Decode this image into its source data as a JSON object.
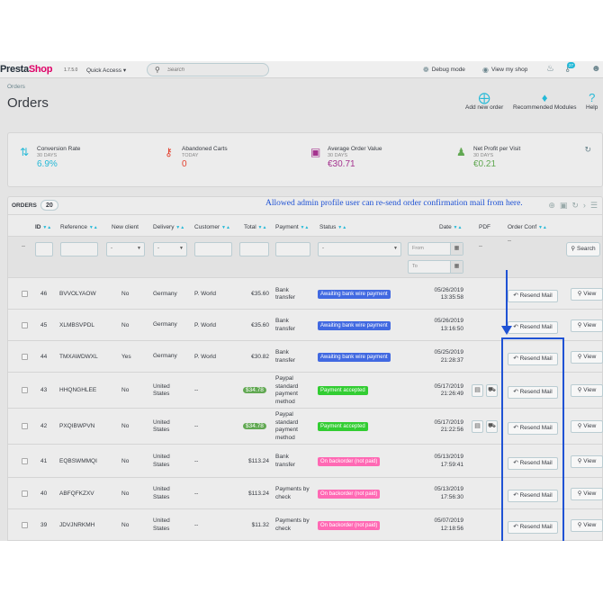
{
  "topbar": {
    "logo_a": "Presta",
    "logo_b": "Shop",
    "version": "1.7.5.0",
    "quick_access": "Quick Access ▾",
    "search_placeholder": "Search",
    "debug_mode": "Debug mode",
    "view_shop": "View my shop",
    "cart_badge": "27"
  },
  "header": {
    "breadcrumb": "Orders",
    "title": "Orders",
    "add_new_order": "Add new order",
    "recommended_modules": "Recommended Modules",
    "help": "Help"
  },
  "kpis": [
    {
      "title": "Conversion Rate",
      "period": "30 DAYS",
      "value": "6.9%",
      "color": "#25b9d7"
    },
    {
      "title": "Abandoned Carts",
      "period": "TODAY",
      "value": "0",
      "color": "#e3412f"
    },
    {
      "title": "Average Order Value",
      "period": "30 DAYS",
      "value": "€30.71",
      "color": "#a5348f"
    },
    {
      "title": "Net Profit per Visit",
      "period": "30 DAYS",
      "value": "€0.21",
      "color": "#61a852"
    }
  ],
  "orders_panel": {
    "title": "ORDERS",
    "count": "20",
    "annotation": "Allowed admin profile user can re-send order confirmation mail from here."
  },
  "columns": {
    "id": "ID",
    "reference": "Reference",
    "new_client": "New client",
    "delivery": "Delivery",
    "customer": "Customer",
    "total": "Total",
    "payment": "Payment",
    "status": "Status",
    "date": "Date",
    "pdf": "PDF",
    "order_conf": "Order Conf"
  },
  "filters": {
    "dash": "--",
    "select_dash": "-",
    "from": "From",
    "to": "To",
    "search_button": "Search"
  },
  "buttons": {
    "resend": "Resend Mail",
    "view": "View"
  },
  "orders": [
    {
      "id": "46",
      "ref": "BVVOLYAOW",
      "new_client": "No",
      "delivery": "Germany",
      "customer": "P. World",
      "total": "€35.60",
      "payment": "Bank\ntransfer",
      "status": "Awaiting bank wire payment",
      "status_color": "#4169e1",
      "date": "05/26/2019",
      "time": "13:35:58"
    },
    {
      "id": "45",
      "ref": "XLMBSVPDL",
      "new_client": "No",
      "delivery": "Germany",
      "customer": "P. World",
      "total": "€35.60",
      "payment": "Bank\ntransfer",
      "status": "Awaiting bank wire payment",
      "status_color": "#4169e1",
      "date": "05/26/2019",
      "time": "13:16:50"
    },
    {
      "id": "44",
      "ref": "TMXAWDWXL",
      "new_client": "Yes",
      "delivery": "Germany",
      "customer": "P. World",
      "total": "€30.82",
      "payment": "Bank\ntransfer",
      "status": "Awaiting bank wire payment",
      "status_color": "#4169e1",
      "date": "05/25/2019",
      "time": "21:28:37"
    },
    {
      "id": "43",
      "ref": "HHQNGHLEE",
      "new_client": "No",
      "delivery": "United\nStates",
      "customer": "--",
      "total": "$34.78",
      "payment": "Paypal\nstandard\npayment\nmethod",
      "status": "Payment accepted",
      "status_color": "#32cd32",
      "date": "05/17/2019",
      "time": "21:26:49",
      "pdf": true
    },
    {
      "id": "42",
      "ref": "PXQIBWPVN",
      "new_client": "No",
      "delivery": "United\nStates",
      "customer": "--",
      "total": "$34.78",
      "payment": "Paypal\nstandard\npayment\nmethod",
      "status": "Payment accepted",
      "status_color": "#32cd32",
      "date": "05/17/2019",
      "time": "21:22:56",
      "pdf": true
    },
    {
      "id": "41",
      "ref": "EQBSWMMQI",
      "new_client": "No",
      "delivery": "United\nStates",
      "customer": "--",
      "total": "$113.24",
      "payment": "Bank\ntransfer",
      "status": "On backorder (not paid)",
      "status_color": "#ff69b4",
      "date": "05/13/2019",
      "time": "17:59:41"
    },
    {
      "id": "40",
      "ref": "ABFQFKZXV",
      "new_client": "No",
      "delivery": "United\nStates",
      "customer": "--",
      "total": "$113.24",
      "payment": "Payments by\ncheck",
      "status": "On backorder (not paid)",
      "status_color": "#ff69b4",
      "date": "05/13/2019",
      "time": "17:56:30"
    },
    {
      "id": "39",
      "ref": "JDVJNRKMH",
      "new_client": "No",
      "delivery": "United\nStates",
      "customer": "--",
      "total": "$11.32",
      "payment": "Payments by\ncheck",
      "status": "On backorder (not paid)",
      "status_color": "#ff69b4",
      "date": "05/07/2019",
      "time": "12:18:56"
    }
  ]
}
